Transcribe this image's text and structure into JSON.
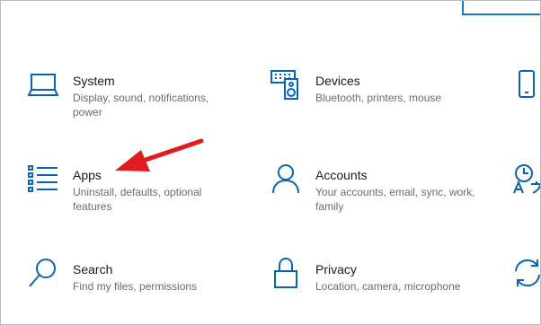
{
  "accent_color": "#0a64b4",
  "annotation_color": "#e01c1c",
  "tiles": [
    {
      "title": "System",
      "description": "Display, sound, notifications, power",
      "icon": "laptop-icon"
    },
    {
      "title": "Devices",
      "description": "Bluetooth, printers, mouse",
      "icon": "keyboard-speaker-icon"
    },
    {
      "title": "Phone",
      "description": "",
      "icon": "phone-icon"
    },
    {
      "title": "Apps",
      "description": "Uninstall, defaults, optional features",
      "icon": "apps-list-icon"
    },
    {
      "title": "Accounts",
      "description": "Your accounts, email, sync, work, family",
      "icon": "person-icon"
    },
    {
      "title": "Time & Language",
      "description": "",
      "icon": "clock-language-icon"
    },
    {
      "title": "Search",
      "description": "Find my files, permissions",
      "icon": "search-icon"
    },
    {
      "title": "Privacy",
      "description": "Location, camera, microphone",
      "icon": "lock-icon"
    },
    {
      "title": "Update & Security",
      "description": "",
      "icon": "sync-icon"
    }
  ]
}
